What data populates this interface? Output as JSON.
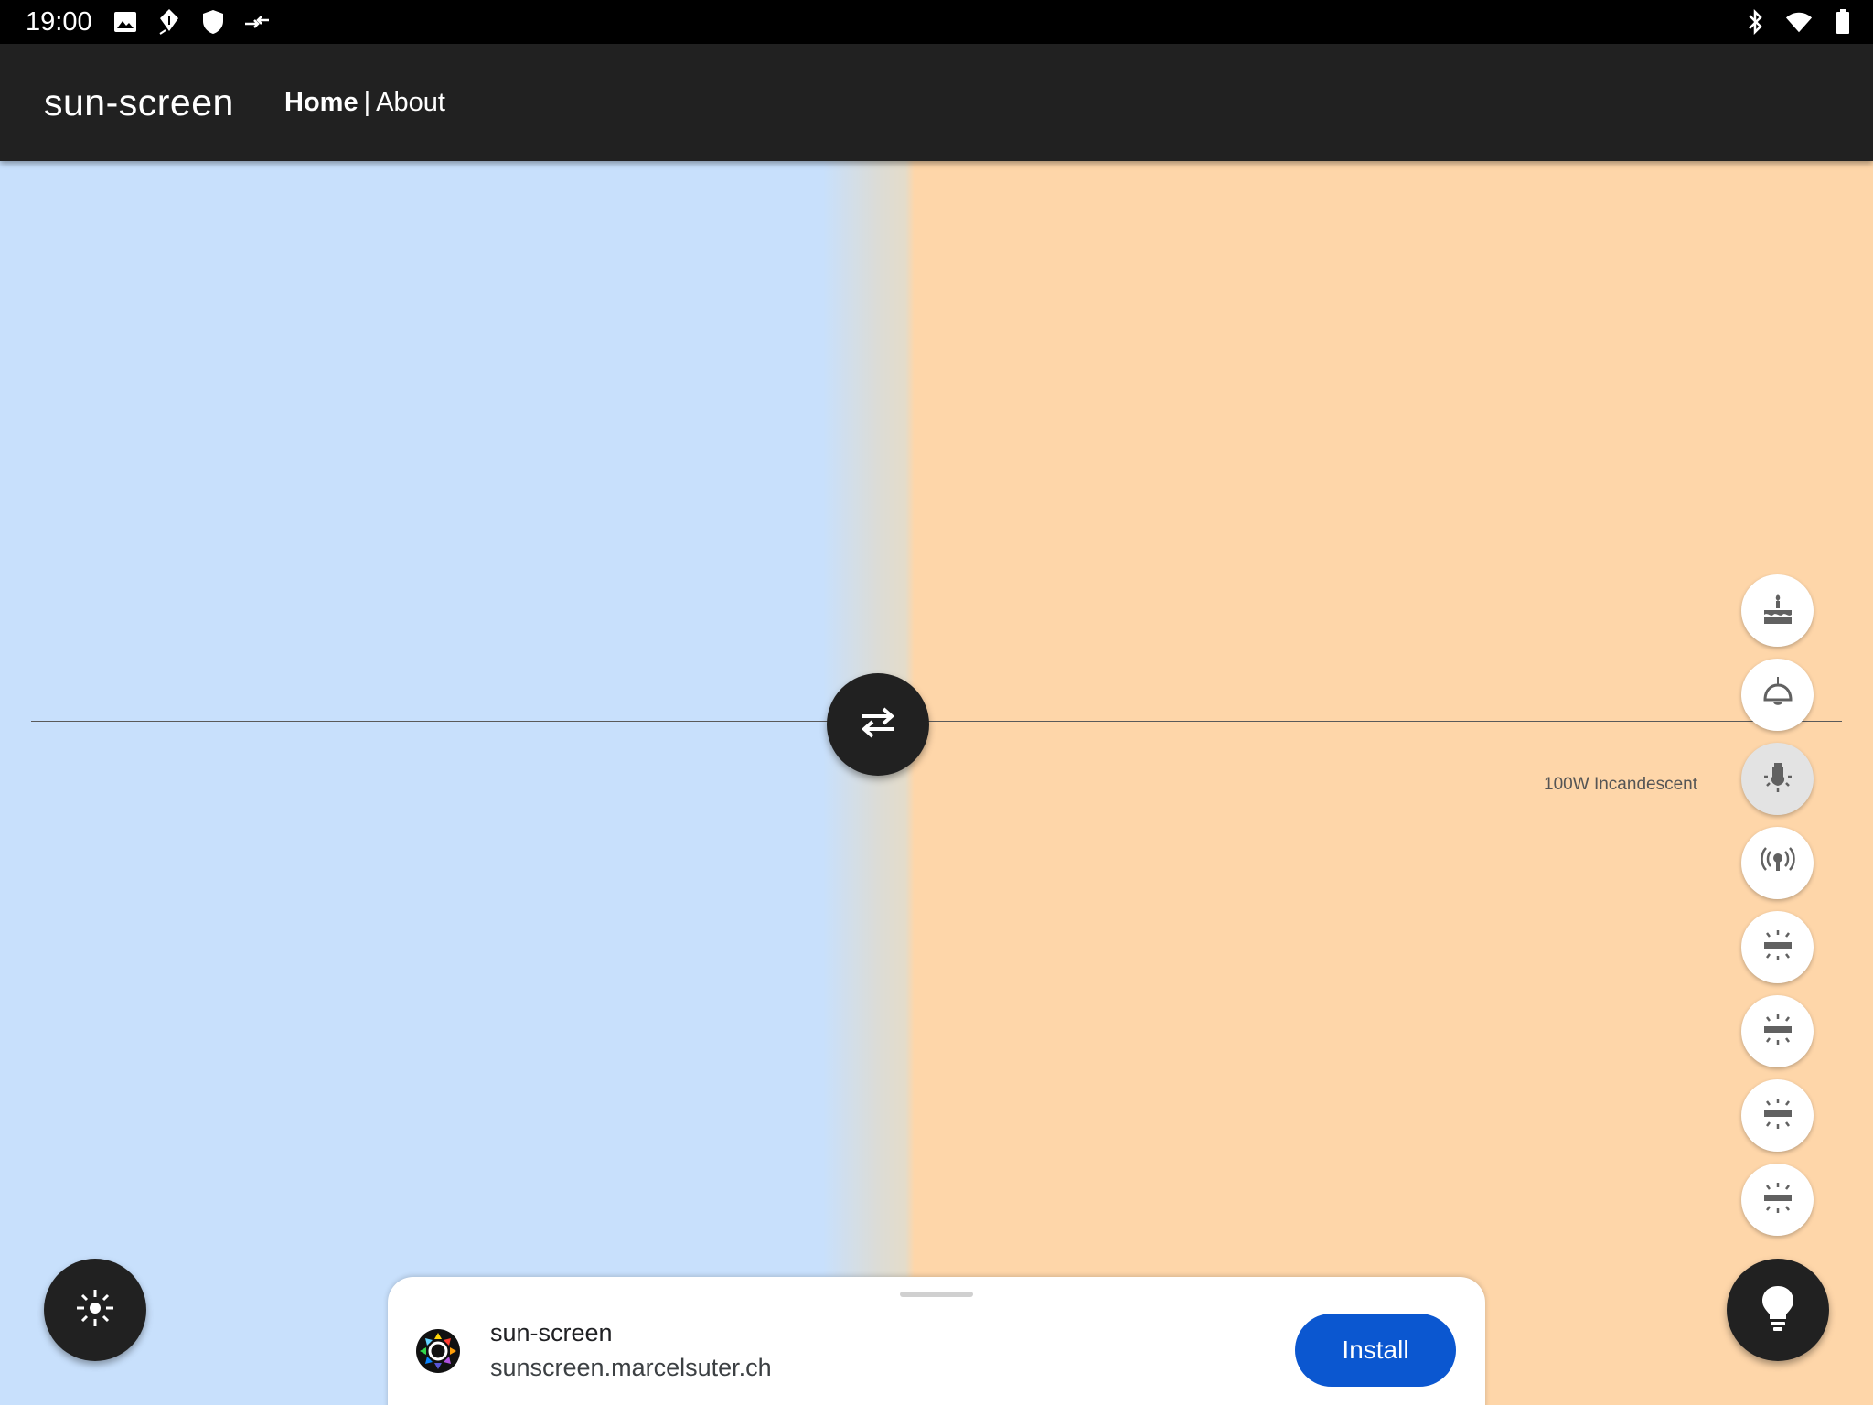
{
  "status_bar": {
    "time": "19:00",
    "left_icons": [
      "image-icon",
      "pen-nib-icon",
      "shield-icon",
      "data-transfer-icon"
    ],
    "right_icons": [
      "bluetooth-icon",
      "wifi-icon",
      "battery-icon"
    ]
  },
  "app_bar": {
    "title": "sun-screen",
    "nav": {
      "home": "Home",
      "separator": "|",
      "about": "About"
    }
  },
  "panes": {
    "left_color": "#c8e0fc",
    "right_color": "#fed6a9"
  },
  "swap_button": {
    "icon": "swap-horizontal-icon"
  },
  "presets": {
    "selected_label": "100W Incandescent",
    "items": [
      {
        "icon": "birthday-candle-icon",
        "selected": false
      },
      {
        "icon": "pendant-lamp-icon",
        "selected": false
      },
      {
        "icon": "incandescent-bulb-icon",
        "selected": true
      },
      {
        "icon": "broadcast-light-icon",
        "selected": false
      },
      {
        "icon": "fluorescent-tube-icon",
        "selected": false
      },
      {
        "icon": "fluorescent-tube-icon",
        "selected": false
      },
      {
        "icon": "fluorescent-tube-icon",
        "selected": false
      },
      {
        "icon": "fluorescent-tube-icon",
        "selected": false
      }
    ]
  },
  "fabs": {
    "left_icon": "brightness-icon",
    "right_icon": "lightbulb-icon"
  },
  "install_sheet": {
    "app_name": "sun-screen",
    "url": "sunscreen.marcelsuter.ch",
    "install_label": "Install"
  }
}
